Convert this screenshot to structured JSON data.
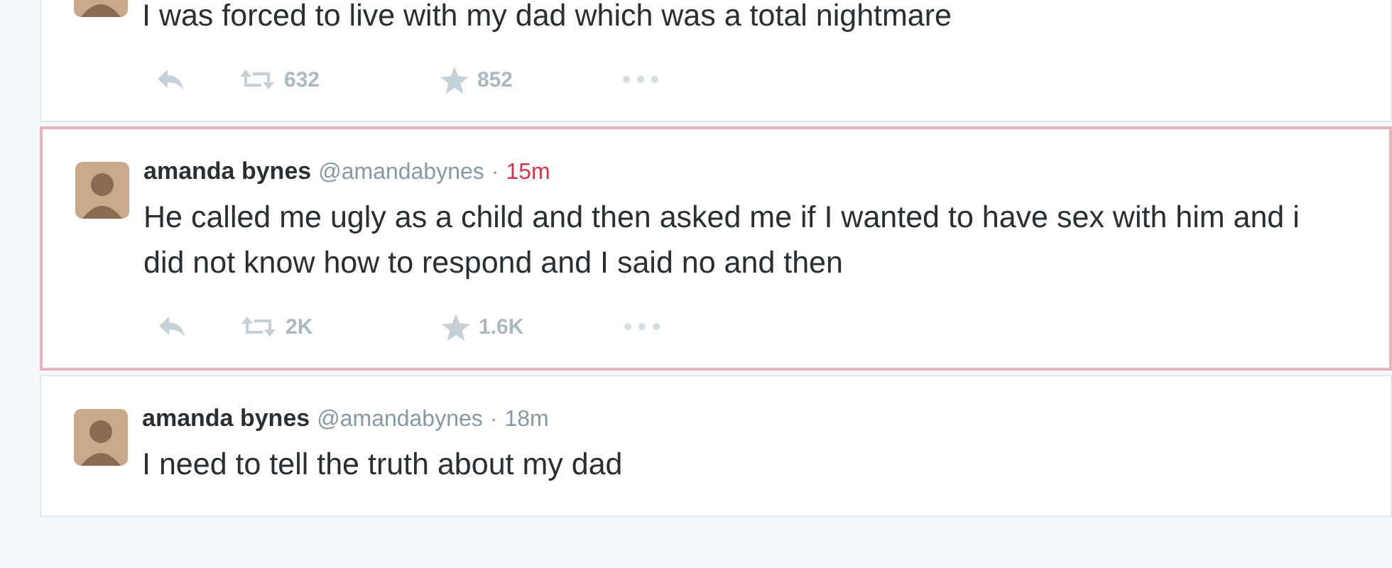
{
  "tweets": [
    {
      "highlighted": false,
      "text": "I was forced to live with my dad which was a total nightmare",
      "retweets": "632",
      "favorites": "852"
    },
    {
      "highlighted": true,
      "name": "amanda bynes",
      "handle": "@amandabynes",
      "separator": "·",
      "time": "15m",
      "text": "He called me ugly as a child and then asked me if I wanted to have sex with him and i did not know how to respond and I said no and then",
      "retweets": "2K",
      "favorites": "1.6K"
    },
    {
      "highlighted": false,
      "name": "amanda bynes",
      "handle": "@amandabynes",
      "separator": "·",
      "time": "18m",
      "text": "I need to tell the truth about my dad"
    }
  ]
}
